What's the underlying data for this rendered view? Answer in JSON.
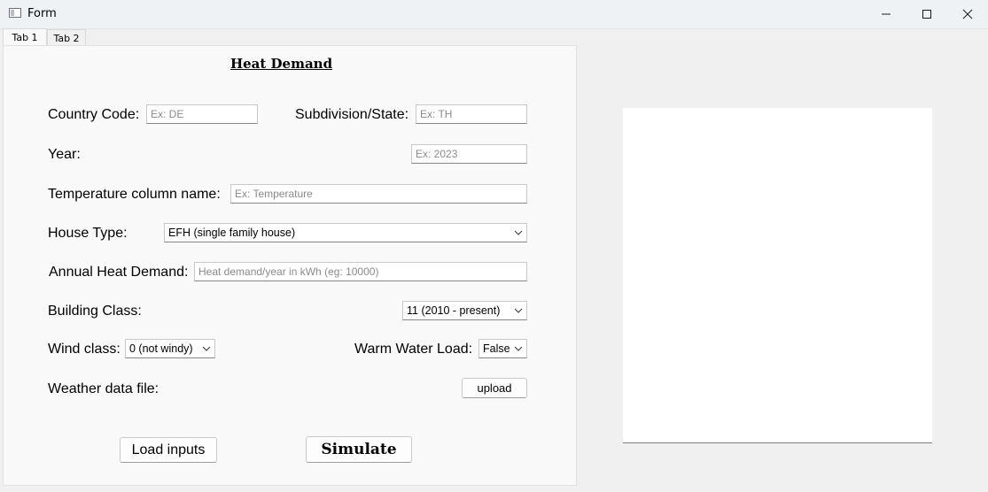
{
  "window": {
    "title": "Form",
    "icon": "form-window-icon",
    "controls": [
      "minimize-icon",
      "maximize-icon",
      "close-icon"
    ]
  },
  "tabs": [
    {
      "label": "Tab 1",
      "active": true
    },
    {
      "label": "Tab 2",
      "active": false
    }
  ],
  "form": {
    "heading": "Heat Demand",
    "country_code": {
      "label": "Country Code:",
      "placeholder": "Ex: DE"
    },
    "subdivision": {
      "label": "Subdivision/State:",
      "placeholder": "Ex: TH"
    },
    "year": {
      "label": "Year:",
      "placeholder": "Ex: 2023"
    },
    "temperature_column": {
      "label": "Temperature column name:",
      "placeholder": "Ex: Temperature"
    },
    "house_type": {
      "label": "House Type:",
      "value": "EFH (single family house)"
    },
    "annual_heat_demand": {
      "label": "Annual Heat Demand:",
      "placeholder": "Heat demand/year in kWh (eg: 10000)"
    },
    "building_class": {
      "label": "Building Class:",
      "value": "11 (2010 -  present)"
    },
    "wind_class": {
      "label": "Wind class:",
      "value": "0 (not windy)"
    },
    "warm_water_load": {
      "label": "Warm Water Load:",
      "value": "False"
    },
    "weather_data_file": {
      "label": "Weather data file:",
      "button": "upload"
    },
    "load_inputs_button": "Load inputs",
    "simulate_button": "Simulate"
  },
  "colors": {
    "window_bg": "#f0f0f0",
    "panel_bg": "#f9f9f9",
    "titlebar_bg": "#eef2f5",
    "canvas_bg": "#ffffff"
  }
}
